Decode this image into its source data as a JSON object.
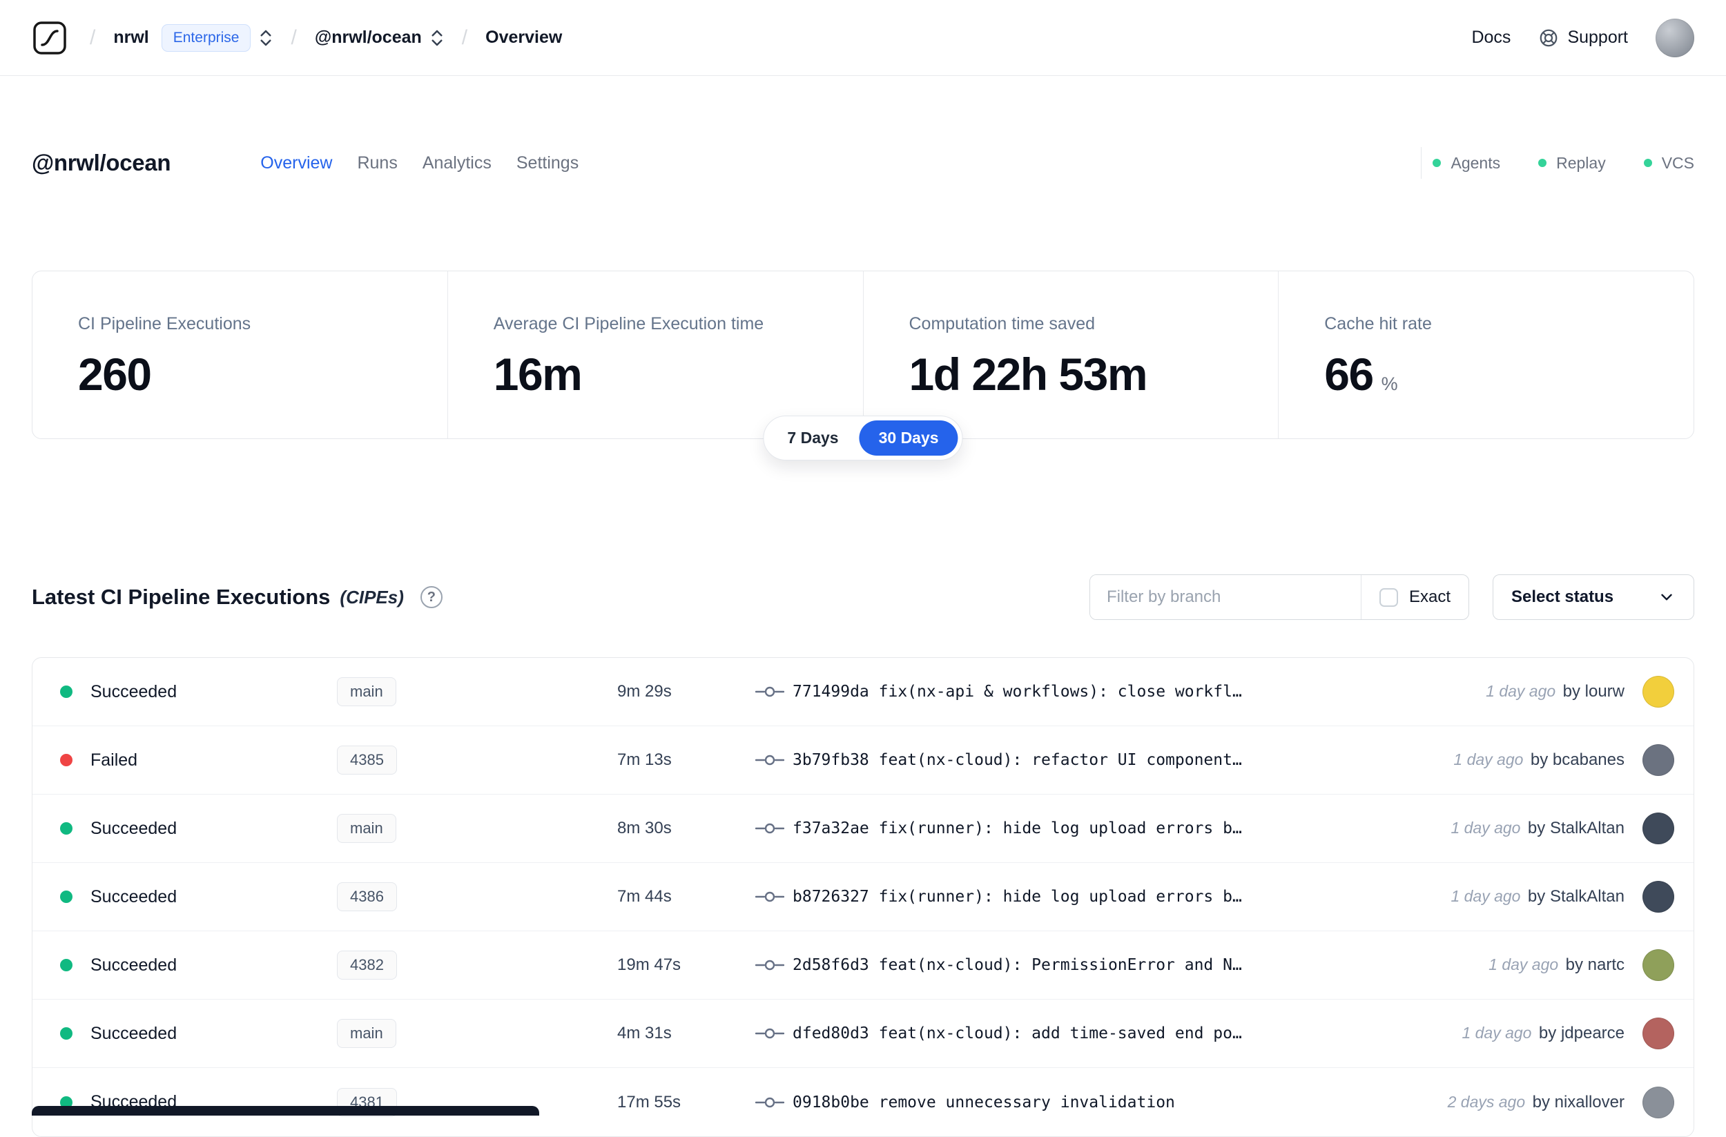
{
  "navbar": {
    "separator": "/",
    "org": "nrwl",
    "badge": "Enterprise",
    "workspace": "@nrwl/ocean",
    "page": "Overview",
    "docs": "Docs",
    "support": "Support"
  },
  "header": {
    "title": "@nrwl/ocean",
    "tabs": [
      {
        "label": "Overview",
        "active": true
      },
      {
        "label": "Runs",
        "active": false
      },
      {
        "label": "Analytics",
        "active": false
      },
      {
        "label": "Settings",
        "active": false
      }
    ],
    "status_links": [
      "Agents",
      "Replay",
      "VCS"
    ]
  },
  "stats": [
    {
      "label": "CI Pipeline Executions",
      "value": "260"
    },
    {
      "label": "Average CI Pipeline Execution time",
      "value": "16m"
    },
    {
      "label": "Computation time saved",
      "value": "1d 22h 53m"
    },
    {
      "label": "Cache hit rate",
      "value": "66",
      "suffix": "%"
    }
  ],
  "range_toggle": {
    "options": [
      {
        "label": "7 Days",
        "active": false
      },
      {
        "label": "30 Days",
        "active": true
      }
    ]
  },
  "cipes": {
    "title": "Latest CI Pipeline Executions",
    "subtitle": "(CIPEs)",
    "help_glyph": "?",
    "filter_placeholder": "Filter by branch",
    "exact_label": "Exact",
    "select_status_label": "Select status"
  },
  "table": {
    "rows": [
      {
        "status": "Succeeded",
        "status_color": "green",
        "branch": "main",
        "duration": "9m 29s",
        "commit": "771499da fix(nx-api & workflows): close workfl…",
        "time": "1 day ago",
        "author": "by lourw",
        "avatar_color": "#f2cf3c"
      },
      {
        "status": "Failed",
        "status_color": "red",
        "branch": "4385",
        "duration": "7m 13s",
        "commit": "3b79fb38 feat(nx-cloud): refactor UI component…",
        "time": "1 day ago",
        "author": "by bcabanes",
        "avatar_color": "#6b7280"
      },
      {
        "status": "Succeeded",
        "status_color": "green",
        "branch": "main",
        "duration": "8m 30s",
        "commit": "f37a32ae fix(runner): hide log upload errors b…",
        "time": "1 day ago",
        "author": "by StalkAltan",
        "avatar_color": "#3f4a5a"
      },
      {
        "status": "Succeeded",
        "status_color": "green",
        "branch": "4386",
        "duration": "7m 44s",
        "commit": "b8726327 fix(runner): hide log upload errors b…",
        "time": "1 day ago",
        "author": "by StalkAltan",
        "avatar_color": "#3f4a5a"
      },
      {
        "status": "Succeeded",
        "status_color": "green",
        "branch": "4382",
        "duration": "19m 47s",
        "commit": "2d58f6d3 feat(nx-cloud): PermissionError and N…",
        "time": "1 day ago",
        "author": "by nartc",
        "avatar_color": "#8fa05a"
      },
      {
        "status": "Succeeded",
        "status_color": "green",
        "branch": "main",
        "duration": "4m 31s",
        "commit": "dfed80d3 feat(nx-cloud): add time-saved end po…",
        "time": "1 day ago",
        "author": "by jdpearce",
        "avatar_color": "#b4635f"
      },
      {
        "status": "Succeeded",
        "status_color": "green",
        "branch": "4381",
        "duration": "17m 55s",
        "commit": "0918b0be remove unnecessary invalidation",
        "time": "2 days ago",
        "author": "by nixallover",
        "avatar_color": "#8a9099"
      }
    ]
  },
  "colors": {
    "accent": "#2563eb",
    "success_dot": "#10b981",
    "failed_dot": "#ef4444",
    "header_dot": "#34d399"
  },
  "icons": {
    "logo": "nx-cloud-logo",
    "switcher": "chevron-up-down",
    "support": "lifebuoy",
    "help": "question-mark-circle",
    "commit": "git-commit",
    "select_chevron": "chevron-down"
  }
}
